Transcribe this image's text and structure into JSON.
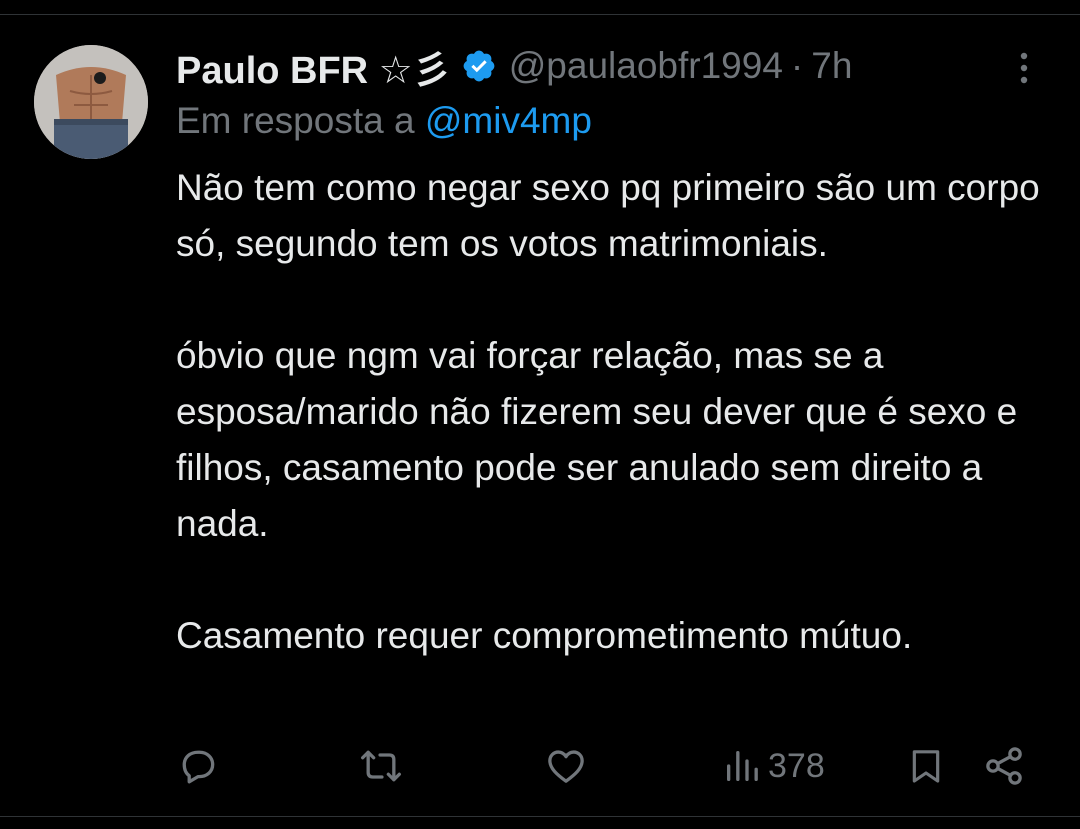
{
  "tweet": {
    "display_name": "Paulo BFR ☆彡",
    "handle": "@paulaobfr1994",
    "separator": "·",
    "time": "7h",
    "reply_prefix": "Em resposta a",
    "reply_to": "@miv4mp",
    "paragraphs": [
      "Não tem como negar sexo pq primeiro são um corpo só, segundo tem os votos matrimoniais.",
      "óbvio que ngm vai forçar relação, mas se a esposa/marido não fizerem seu dever que é sexo e filhos, casamento pode ser anulado sem direito a nada.",
      "Casamento requer comprometimento mútuo."
    ],
    "verified": true
  },
  "actions": {
    "views": "378",
    "icons": [
      "reply-icon",
      "retweet-icon",
      "like-icon",
      "views-icon",
      "bookmark-icon",
      "share-icon"
    ]
  },
  "theme": {
    "background": "#000000",
    "text": "#e7e9ea",
    "muted": "#71767b",
    "accent": "#1d9bf0"
  }
}
